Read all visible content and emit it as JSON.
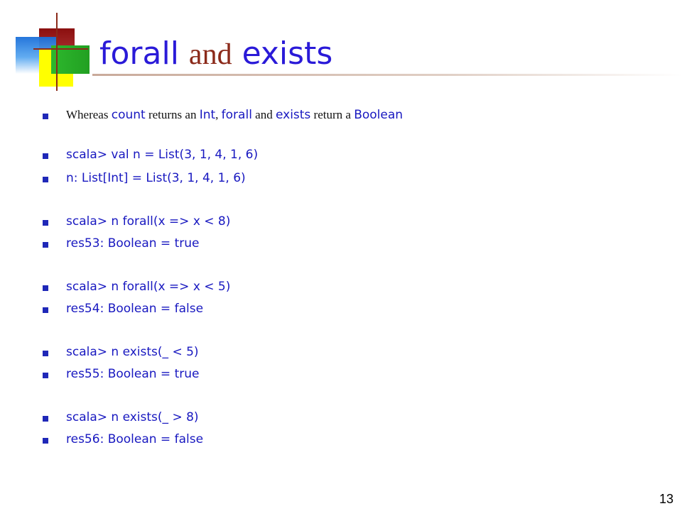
{
  "title": {
    "part1": "forall",
    "part2": "and",
    "part3": "exists"
  },
  "intro": {
    "w1": "Whereas ",
    "c1": "count",
    "w2": " returns an ",
    "c2": "Int",
    "w3": ", ",
    "c3": "forall",
    "w4": " and ",
    "c4": "exists",
    "w5": " return a ",
    "c5": "Boolean"
  },
  "lines": [
    "scala> val n = List(3, 1, 4, 1, 6)",
    "n: List[Int] = List(3, 1, 4, 1, 6)",
    "scala> n forall(x => x < 8)",
    "res53: Boolean = true",
    "scala> n forall(x => x < 5)",
    "res54: Boolean = false",
    "scala> n exists(_ < 5)",
    "res55: Boolean = true",
    "scala> n exists(_ > 8)",
    "res56: Boolean = false"
  ],
  "page_number": "13"
}
